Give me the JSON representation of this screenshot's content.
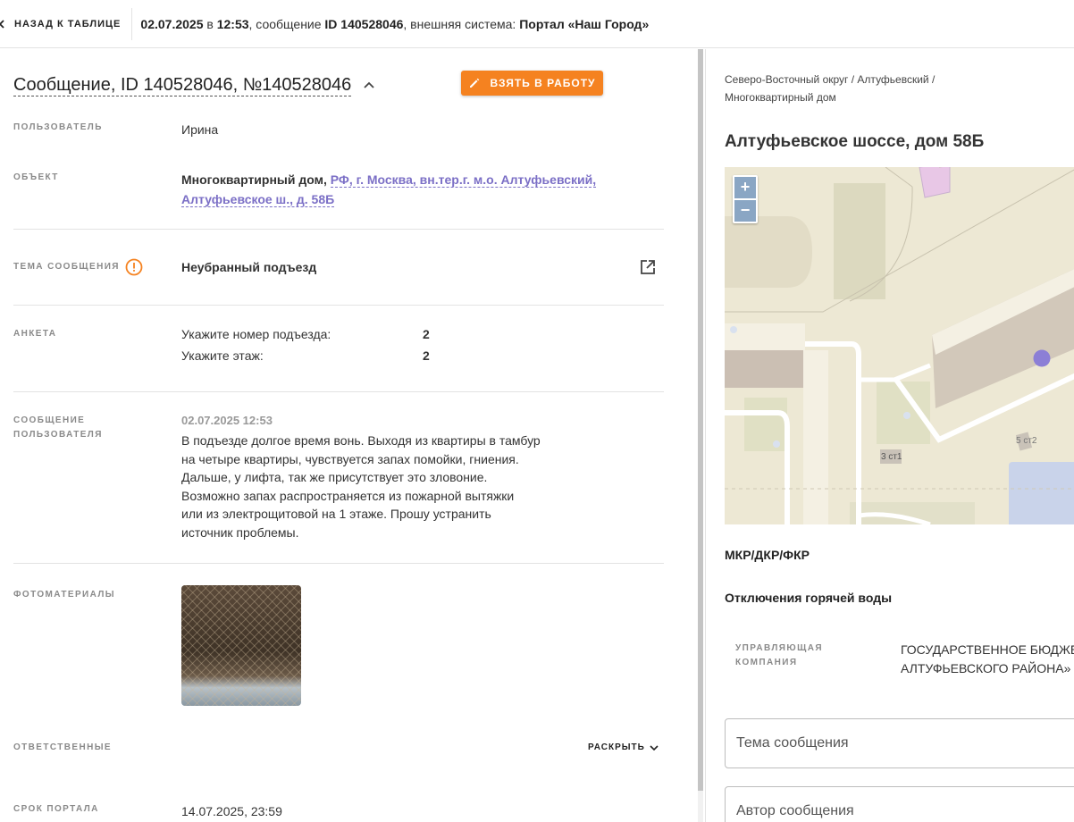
{
  "topbar": {
    "back_label": "НАЗАД К ТАБЛИЦЕ",
    "date": "02.07.2025",
    "in_word": "в",
    "time": "12:53",
    "message_word": ", сообщение",
    "message_id": "ID 140528046",
    "system_word": ", внешняя система:",
    "system_name": "Портал «Наш Город»"
  },
  "message": {
    "title": "Сообщение, ID 140528046, №140528046",
    "take_button": "ВЗЯТЬ В РАБОТУ",
    "user_label": "ПОЛЬЗОВАТЕЛЬ",
    "user_value": "Ирина",
    "object_label": "ОБЪЕКТ",
    "object_type": "Многоквартирный дом,",
    "object_address": "РФ, г. Москва, вн.тер.г. м.о. Алтуфьевский, Алтуфьевское ш., д. 58Б",
    "topic_label": "ТЕМА СООБЩЕНИЯ",
    "topic_value": "Неубранный подъезд",
    "survey_label": "АНКЕТА",
    "survey": [
      {
        "q": "Укажите номер подъезда:",
        "a": "2"
      },
      {
        "q": "Укажите этаж:",
        "a": "2"
      }
    ],
    "user_msg_label": [
      "СООБЩЕНИЕ",
      "ПОЛЬЗОВАТЕЛЯ"
    ],
    "user_msg_date": "02.07.2025 12:53",
    "user_msg_lines": [
      "В подъезде долгое время вонь. Выходя из квартиры в тамбур",
      "на четыре квартиры, чувствуется запах помойки, гниения.",
      "Дальше, у лифта, так же присутствует это зловоние.",
      "Возможно запах распространяется из пожарной вытяжки",
      "или из электрощитовой на 1 этаже. Прошу устранить",
      "источник проблемы."
    ],
    "photos_label": "ФОТОМАТЕРИАЛЫ",
    "responsible_label": "ОТВЕТСТВЕННЫЕ",
    "expand_label": "РАСКРЫТЬ",
    "deadline_label": "СРОК ПОРТАЛА",
    "deadline_value": "14.07.2025, 23:59"
  },
  "side": {
    "breadcrumb_1": "Северо-Восточный округ / Алтуфьевский /",
    "breadcrumb_2": "Многоквартирный дом",
    "address": "Алтуфьевское шоссе, дом 58Б",
    "zoom_in": "+",
    "zoom_out": "−",
    "map_labels": [
      "5 ст2",
      "3 ст1"
    ],
    "mkr": "МКР/ДКР/ФКР",
    "hot_water": "Отключения горячей воды",
    "uk_label": [
      "УПРАВЛЯЮЩАЯ",
      "КОМПАНИЯ"
    ],
    "uk_value": [
      "ГОСУДАРСТВЕННОЕ БЮДЖЕТ",
      "АЛТУФЬЕВСКОГО РАЙОНА»"
    ],
    "topic_placeholder": "Тема сообщения",
    "author_placeholder": "Автор сообщения"
  },
  "colors": {
    "accent": "#f58220",
    "link": "#7b6fc6",
    "marker": "#8c7fd6"
  },
  "icons": [
    "chevron-left-icon",
    "chevron-up-icon",
    "pencil-icon",
    "warning-circle-icon",
    "external-link-icon",
    "chevron-down-icon"
  ]
}
